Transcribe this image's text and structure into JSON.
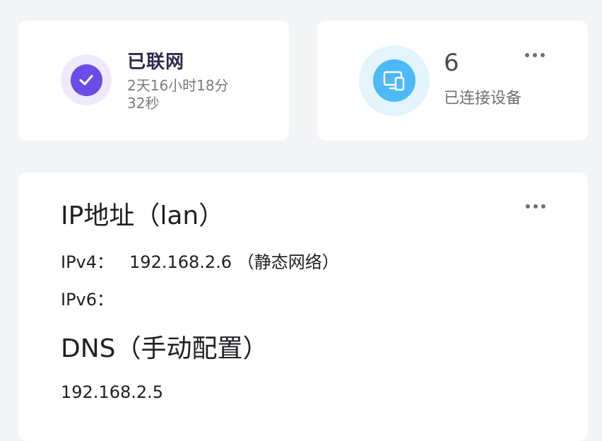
{
  "status_card": {
    "title": "已联网",
    "uptime": "2天16小时18分32秒",
    "icon": "check-icon",
    "accent": "#6a4ce6"
  },
  "devices_card": {
    "count": "6",
    "label": "已连接设备",
    "icon": "devices-icon",
    "accent": "#4db9f7"
  },
  "network_card": {
    "ip_title": "IP地址（lan）",
    "ipv4_label": "IPv4：",
    "ipv4_value": "192.168.2.6 （静态网络）",
    "ipv6_label": "IPv6：",
    "dns_title": "DNS（手动配置）",
    "dns_value": "192.168.2.5"
  }
}
